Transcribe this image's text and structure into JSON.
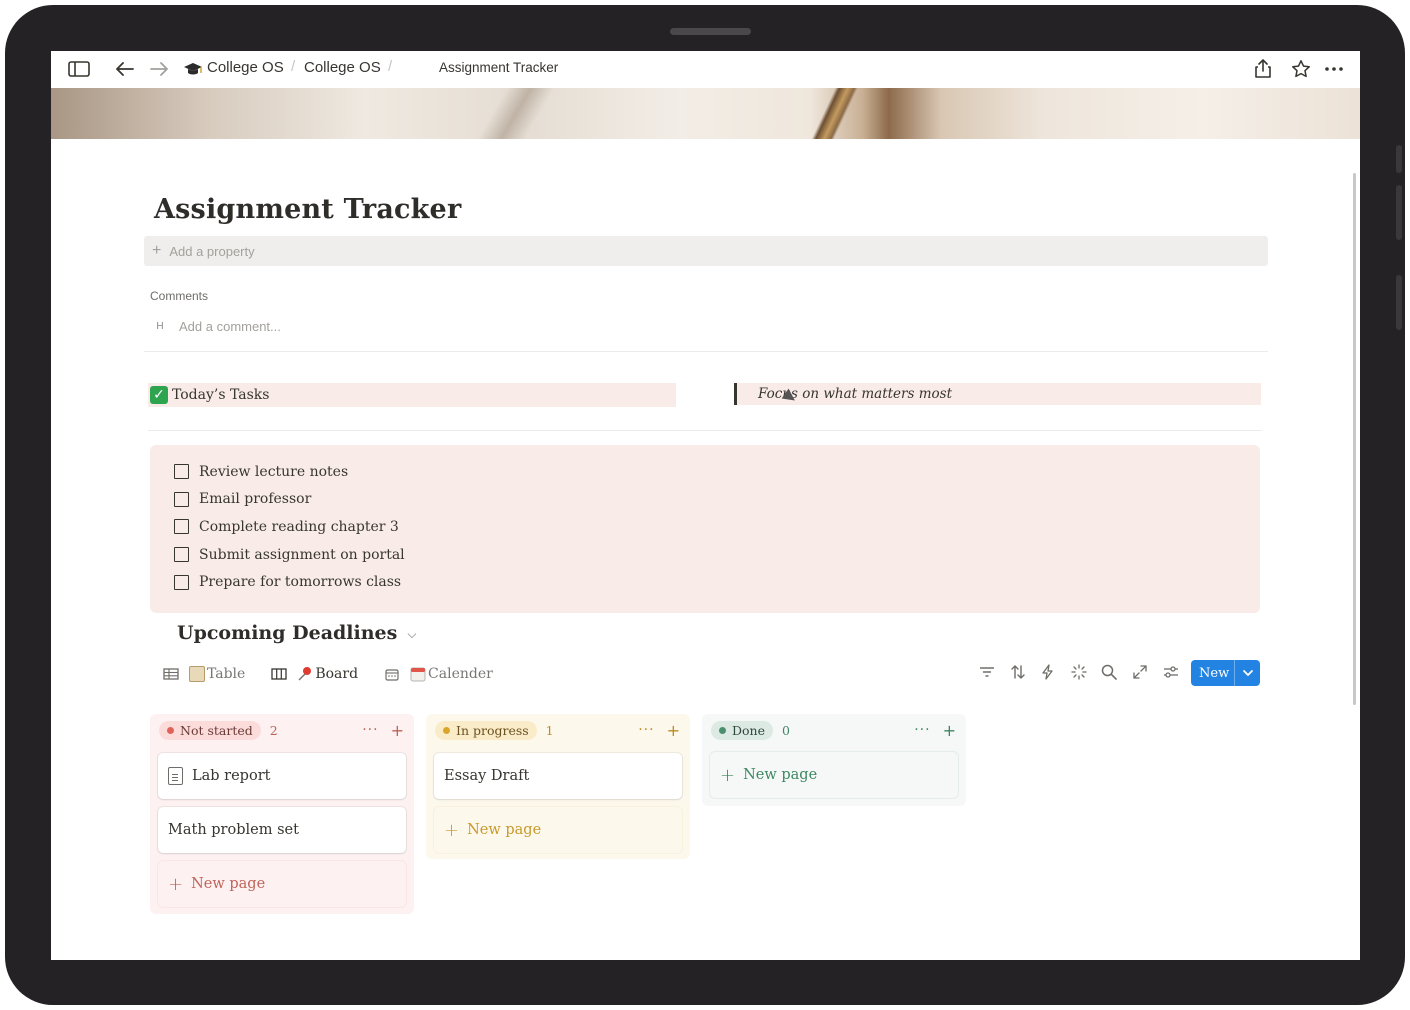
{
  "breadcrumb": {
    "workspace": "College OS",
    "parent": "College OS",
    "current": "Assignment Tracker"
  },
  "page": {
    "title": "Assignment Tracker",
    "add_property": "Add a property",
    "comments_label": "Comments",
    "comment_avatar": "H",
    "comment_placeholder": "Add a comment..."
  },
  "todays_tasks": {
    "heading": "Today’s Tasks",
    "quote": "Focus on what matters most",
    "items": [
      {
        "label": "Review lecture notes",
        "checked": false
      },
      {
        "label": "Email professor",
        "checked": false
      },
      {
        "label": "Complete reading chapter 3",
        "checked": false
      },
      {
        "label": "Submit assignment on portal",
        "checked": false
      },
      {
        "label": "Prepare for tomorrows class",
        "checked": false
      }
    ]
  },
  "deadlines": {
    "heading": "Upcoming Deadlines",
    "views": [
      {
        "label": "Table",
        "icon": "table-icon",
        "emoji": "notepad-emoji"
      },
      {
        "label": "Board",
        "icon": "board-icon",
        "emoji": "pushpin-emoji"
      },
      {
        "label": "Calender",
        "icon": "calendar-icon",
        "emoji": "calendar-emoji"
      }
    ],
    "new_button": "New",
    "columns": [
      {
        "status": "Not started",
        "count": "2",
        "colors": {
          "bg": "#fdf1f1",
          "pill": "#fbdcdb",
          "dot": "#e16259",
          "text": "#a6493f"
        },
        "cards": [
          "Lab report",
          "Math problem set"
        ],
        "new_page": "New page"
      },
      {
        "status": "In progress",
        "count": "1",
        "colors": {
          "bg": "#fdf8ec",
          "pill": "#fbecc9",
          "dot": "#d9a62a",
          "text": "#9a7523"
        },
        "cards": [
          "Essay Draft"
        ],
        "new_page": "New page"
      },
      {
        "status": "Done",
        "count": "0",
        "colors": {
          "bg": "#f5f7f6",
          "pill": "#dde9e3",
          "dot": "#4b8f6e",
          "text": "#2f7a57"
        },
        "cards": [],
        "new_page": "New page"
      }
    ]
  },
  "colors": {
    "accent": "#2383e2",
    "task_bg": "#f9ece8"
  }
}
